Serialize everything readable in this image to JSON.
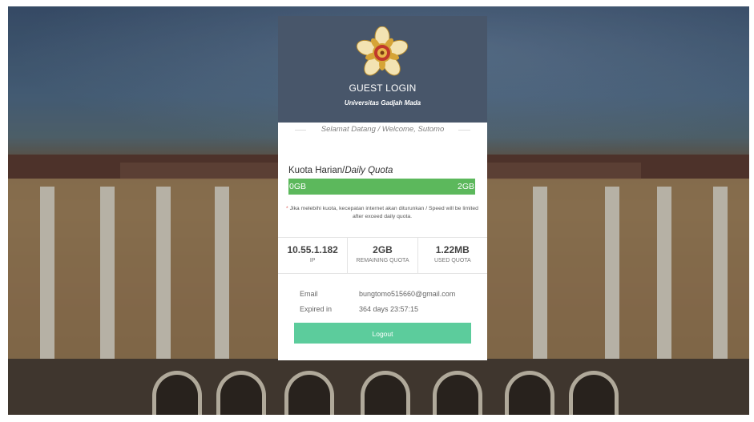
{
  "header": {
    "title": "GUEST LOGIN",
    "subtitle": "Universitas Gadjah Mada",
    "logo_icon": "ugm-seal-icon"
  },
  "welcome": "Selamat Datang / Welcome, Sutomo",
  "quota": {
    "title_prefix": "Kuota Harian/",
    "title_italic": "Daily Quota",
    "bar_min": "0GB",
    "bar_max": "2GB",
    "fill_fraction": 1.0,
    "note_star": "*",
    "note": "Jika melebihi kuota, kecepatan internet akan diturunkan / Speed will be limited after exceed daily quota."
  },
  "stats": [
    {
      "value": "10.55.1.182",
      "label": "IP"
    },
    {
      "value": "2GB",
      "label": "REMAINING QUOTA"
    },
    {
      "value": "1.22MB",
      "label": "USED QUOTA"
    }
  ],
  "info": {
    "email_label": "Email",
    "email_value": "bungtomo515660@gmail.com",
    "expired_label": "Expired in",
    "expired_value": "364 days 23:57:15"
  },
  "logout_label": "Logout",
  "colors": {
    "header_bg": "#48566a",
    "bar_green": "#5cb85c",
    "logout_green": "#5ccc9c"
  }
}
